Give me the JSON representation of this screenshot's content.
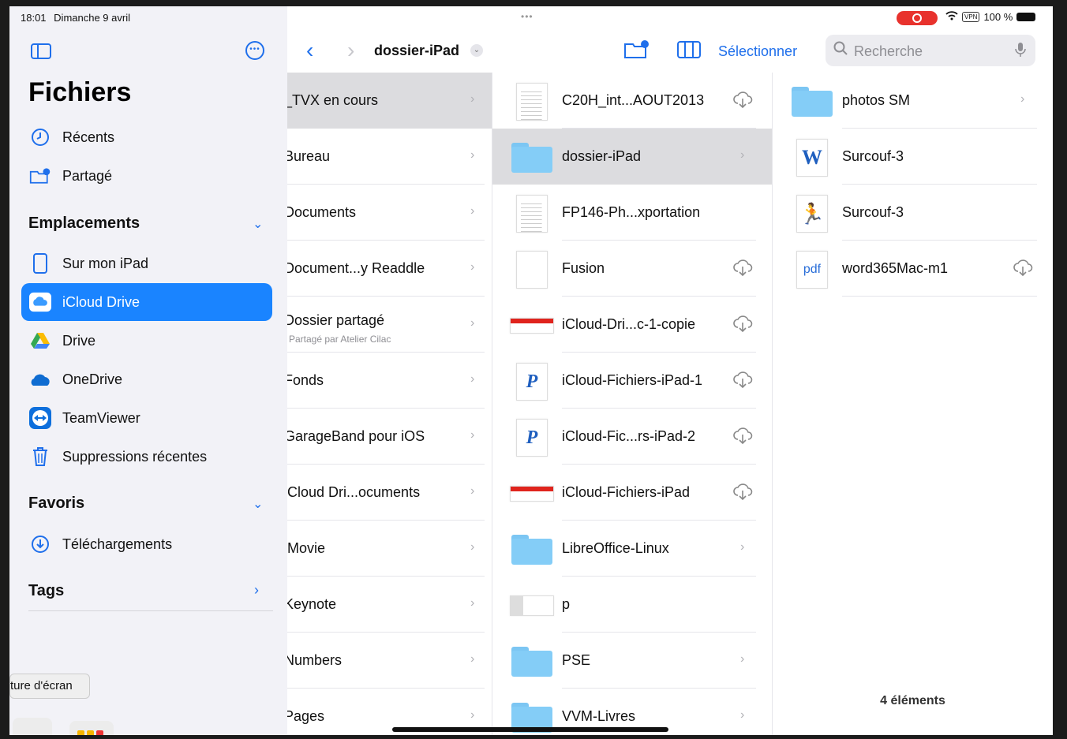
{
  "status": {
    "time": "18:01",
    "date": "Dimanche 9 avril",
    "battery": "100 %",
    "vpn": "VPN"
  },
  "sidebar": {
    "title": "Fichiers",
    "quick": [
      {
        "label": "Récents",
        "icon": "clock-icon"
      },
      {
        "label": "Partagé",
        "icon": "shared-folder-icon"
      }
    ],
    "locations_title": "Emplacements",
    "locations": [
      {
        "label": "Sur mon iPad",
        "icon": "ipad-icon",
        "active": false
      },
      {
        "label": "iCloud Drive",
        "icon": "icloud-icon",
        "active": true
      },
      {
        "label": "Drive",
        "icon": "google-drive-icon",
        "active": false
      },
      {
        "label": "OneDrive",
        "icon": "onedrive-icon",
        "active": false
      },
      {
        "label": "TeamViewer",
        "icon": "teamviewer-icon",
        "active": false
      },
      {
        "label": "Suppressions récentes",
        "icon": "trash-icon",
        "active": false
      }
    ],
    "favorites_title": "Favoris",
    "favorites": [
      {
        "label": "Téléchargements",
        "icon": "download-icon"
      }
    ],
    "tags_title": "Tags",
    "tooltip": "ture d'écran"
  },
  "toolbar": {
    "breadcrumb": "dossier-iPad",
    "select_label": "Sélectionner",
    "search_placeholder": "Recherche"
  },
  "column1": [
    {
      "name": "_TVX en cours",
      "selected": true
    },
    {
      "name": "Bureau"
    },
    {
      "name": "Documents"
    },
    {
      "name": "Document...y Readdle"
    },
    {
      "name": "Dossier partagé",
      "sub": "Partagé par Atelier Cilac"
    },
    {
      "name": "Fonds"
    },
    {
      "name": "GarageBand pour iOS"
    },
    {
      "name": "iCloud Dri...ocuments"
    },
    {
      "name": "iMovie"
    },
    {
      "name": "Keynote"
    },
    {
      "name": "Numbers"
    },
    {
      "name": "Pages"
    }
  ],
  "column2": [
    {
      "name": "C20H_int...AOUT2013",
      "kind": "doc-lines",
      "cloud": true
    },
    {
      "name": "dossier-iPad",
      "kind": "folder",
      "selected": true
    },
    {
      "name": "FP146-Ph...xportation",
      "kind": "doc-lines"
    },
    {
      "name": "Fusion",
      "kind": "doc",
      "cloud": true
    },
    {
      "name": "iCloud-Dri...c-1-copie",
      "kind": "doc-red",
      "cloud": true
    },
    {
      "name": "iCloud-Fichiers-iPad-1",
      "kind": "pages",
      "cloud": true
    },
    {
      "name": "iCloud-Fic...rs-iPad-2",
      "kind": "pages",
      "cloud": true
    },
    {
      "name": "iCloud-Fichiers-iPad",
      "kind": "doc-red",
      "cloud": true
    },
    {
      "name": "LibreOffice-Linux",
      "kind": "folder"
    },
    {
      "name": "p",
      "kind": "image"
    },
    {
      "name": "PSE",
      "kind": "folder"
    },
    {
      "name": "VVM-Livres",
      "kind": "folder"
    }
  ],
  "column3": [
    {
      "name": "photos SM",
      "kind": "folder"
    },
    {
      "name": "Surcouf-3",
      "kind": "word"
    },
    {
      "name": "Surcouf-3",
      "kind": "doc-man"
    },
    {
      "name": "word365Mac-m1",
      "kind": "pdf",
      "cloud": true
    }
  ],
  "column3_count": "4 éléments",
  "glyphs": {
    "pages": "P",
    "word": "W",
    "pdf": "pdf"
  },
  "colors": {
    "accent": "#1f6feb",
    "active": "#1a84ff",
    "folder": "#84cdf7",
    "record": "#e8322d"
  }
}
